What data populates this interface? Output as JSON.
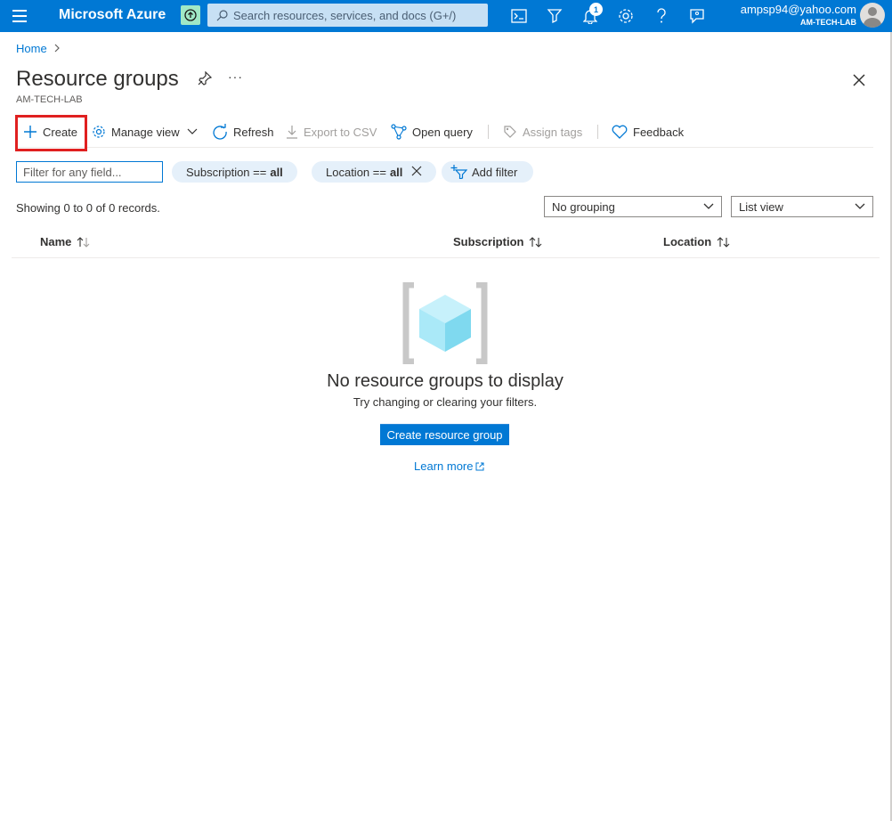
{
  "topbar": {
    "brand": "Microsoft Azure",
    "search_placeholder": "Search resources, services, and docs (G+/)",
    "notification_count": "1",
    "account_email": "ampsp94@yahoo.com",
    "account_tenant": "AM-TECH-LAB",
    "icons": [
      "menu-icon",
      "upgrade-icon",
      "cloud-shell-icon",
      "directory-filter-icon",
      "bell-icon",
      "gear-icon",
      "help-icon",
      "feedback-icon"
    ]
  },
  "breadcrumb": {
    "home": "Home"
  },
  "header": {
    "title": "Resource groups",
    "subtitle": "AM-TECH-LAB",
    "more": "···"
  },
  "commands": {
    "create": "Create",
    "manage_view": "Manage view",
    "refresh": "Refresh",
    "export_csv": "Export to CSV",
    "open_query": "Open query",
    "assign_tags": "Assign tags",
    "feedback": "Feedback"
  },
  "filters": {
    "search_placeholder": "Filter for any field...",
    "subscription_label": "Subscription ==",
    "subscription_value": "all",
    "location_label": "Location ==",
    "location_value": "all",
    "add_filter": "Add filter"
  },
  "list": {
    "records_text": "Showing 0 to 0 of 0 records.",
    "grouping": "No grouping",
    "view": "List view",
    "columns": [
      "Name",
      "Subscription",
      "Location"
    ]
  },
  "empty_state": {
    "title": "No resource groups to display",
    "subtitle": "Try changing or clearing your filters.",
    "button": "Create resource group",
    "learn_more": "Learn more"
  },
  "colors": {
    "accent": "#0078d4",
    "highlight": "#e02020",
    "pill_bg": "#e5f0fa"
  }
}
